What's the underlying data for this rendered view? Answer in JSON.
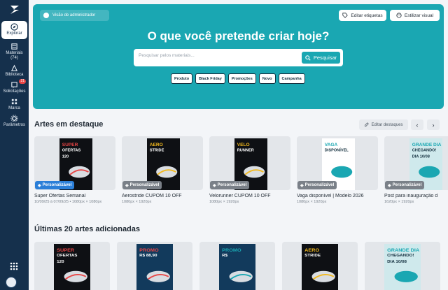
{
  "sidebar": {
    "items": [
      {
        "label": "Explorar",
        "icon": "compass-icon",
        "active": true
      },
      {
        "label": "Materiais",
        "count": "(74)",
        "icon": "folder-icon"
      },
      {
        "label": "Biblioteca",
        "icon": "shapes-icon"
      },
      {
        "label": "Solicitações",
        "badge": "21",
        "icon": "request-icon"
      },
      {
        "label": "Marca",
        "icon": "grid-icon"
      },
      {
        "label": "Parâmetros",
        "icon": "gear-icon"
      }
    ]
  },
  "hero": {
    "admin_label": "Visão de administrador",
    "edit_tags": "Editar etiquetas",
    "visual_style": "Estilizar visual",
    "title": "O que você pretende criar hoje?",
    "search_placeholder": "Pesquisar pelos materiais...",
    "search_button": "Pesquisar",
    "chips": [
      "Produto",
      "Black Friday",
      "Promoções",
      "Novo",
      "Campanha"
    ],
    "accent": "#1aa7b2"
  },
  "featured": {
    "title": "Artes em destaque",
    "edit_label": "Editar destaques",
    "cards": [
      {
        "tag": "Personalizável",
        "title": "Super Ofertas Semanal",
        "sub": "10/09/25 à 07/09/25 • 1080px × 1080px",
        "poster": {
          "l1": "SUPER",
          "l2": "OFERTAS",
          "l3": "120",
          "bg": "#0e1014",
          "accent": "#e84545"
        }
      },
      {
        "tag": "Personalizável",
        "title": "Aerostride CUPOM 10 OFF",
        "sub": "1080px × 1920px",
        "poster": {
          "l1": "AERO",
          "l2": "STRIDE",
          "l3": "",
          "bg": "#0e1014",
          "accent": "#f2b91e"
        }
      },
      {
        "tag": "Personalizável",
        "title": "Velorunner CUPOM 10 OFF",
        "sub": "1080px × 1920px",
        "poster": {
          "l1": "VELO",
          "l2": "RUNNER",
          "l3": "",
          "bg": "#0e1014",
          "accent": "#f2b91e"
        }
      },
      {
        "tag": "Personalizável",
        "title": "Vaga disponível | Modelo 2026",
        "sub": "1080px × 1920px",
        "poster": {
          "l1": "VAGA",
          "l2": "DISPONÍVEL",
          "l3": "",
          "bg": "#ffffff",
          "accent": "#1aa7b2"
        }
      },
      {
        "tag": "Personalizável",
        "title": "Post para inauguração d",
        "sub": "1620px × 1920px",
        "poster": {
          "l1": "GRANDE DIA",
          "l2": "CHEGANDO!",
          "l3": "DIA 10/08",
          "bg": "#cfe9ec",
          "accent": "#1aa7b2"
        }
      }
    ]
  },
  "latest": {
    "title": "Últimas 20 artes adicionadas",
    "cards": [
      {
        "poster": {
          "l1": "SUPER",
          "l2": "OFERTAS",
          "l3": "120",
          "bg": "#0e1014",
          "accent": "#e84545"
        }
      },
      {
        "poster": {
          "l1": "PROMO",
          "l2": "R$ 88,90",
          "l3": "",
          "bg": "#123a5c",
          "accent": "#e84545"
        }
      },
      {
        "poster": {
          "l1": "PROMO",
          "l2": "R$",
          "l3": "",
          "bg": "#123a5c",
          "accent": "#1aa7b2"
        }
      },
      {
        "poster": {
          "l1": "AERO",
          "l2": "STRIDE",
          "l3": "",
          "bg": "#0e1014",
          "accent": "#f2b91e"
        }
      },
      {
        "poster": {
          "l1": "GRANDE DIA",
          "l2": "CHEGANDO!",
          "l3": "DIA 10/08",
          "bg": "#cfe9ec",
          "accent": "#1aa7b2"
        }
      }
    ]
  }
}
